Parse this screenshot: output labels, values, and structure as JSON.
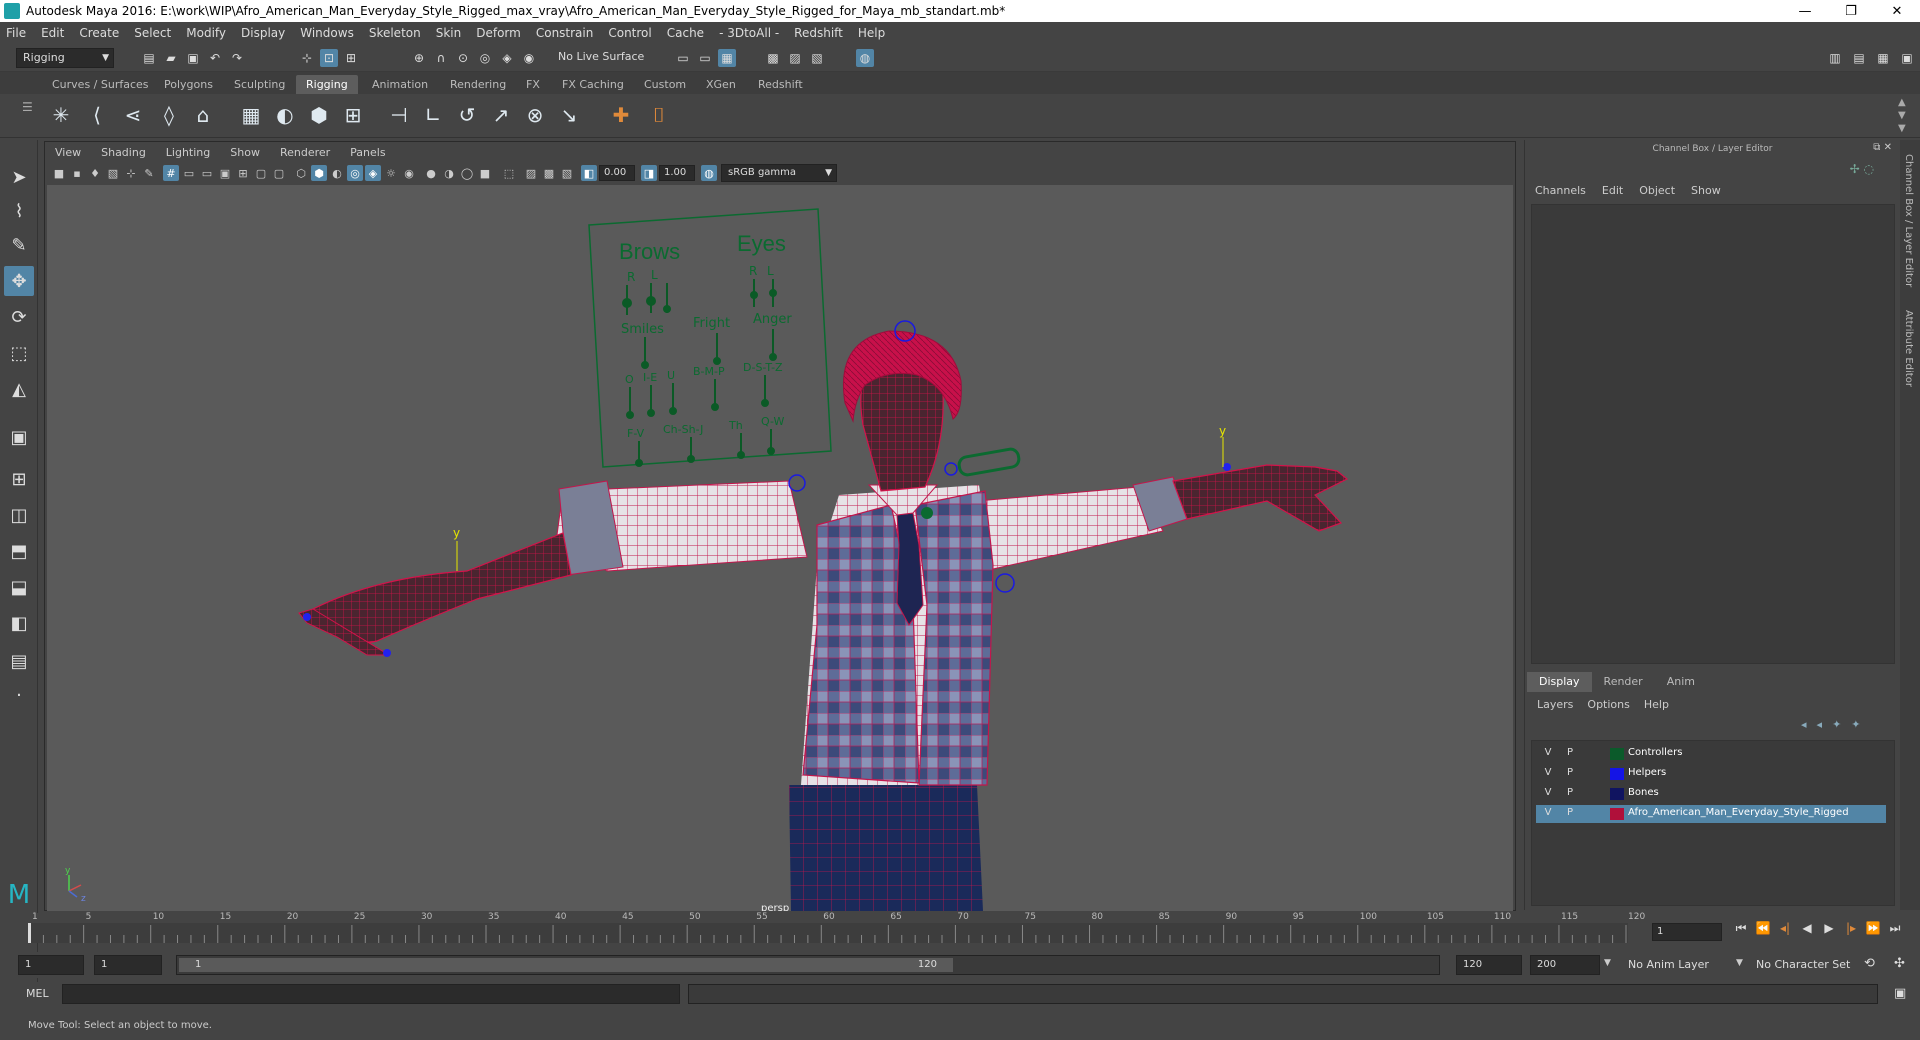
{
  "window": {
    "title": "Autodesk Maya 2016: E:\\work\\WIP\\Afro_American_Man_Everyday_Style_Rigged_max_vray\\Afro_American_Man_Everyday_Style_Rigged_for_Maya_mb_standart.mb*",
    "minimize": "—",
    "restore": "❐",
    "close": "✕"
  },
  "menubar": [
    "File",
    "Edit",
    "Create",
    "Select",
    "Modify",
    "Display",
    "Windows",
    "Skeleton",
    "Skin",
    "Deform",
    "Constrain",
    "Control",
    "Cache",
    "- 3DtoAll -",
    "Redshift",
    "Help"
  ],
  "statusline": {
    "mode": "Rigging",
    "live_surface": "No Live Surface"
  },
  "shelf_tabs": [
    {
      "label": "Curves / Surfaces",
      "active": false
    },
    {
      "label": "Polygons",
      "active": false
    },
    {
      "label": "Sculpting",
      "active": false
    },
    {
      "label": "Rigging",
      "active": true
    },
    {
      "label": "Animation",
      "active": false
    },
    {
      "label": "Rendering",
      "active": false
    },
    {
      "label": "FX",
      "active": false
    },
    {
      "label": "FX Caching",
      "active": false
    },
    {
      "label": "Custom",
      "active": false
    },
    {
      "label": "XGen",
      "active": false
    },
    {
      "label": "Redshift",
      "active": false
    }
  ],
  "panel": {
    "menu": [
      "View",
      "Shading",
      "Lighting",
      "Show",
      "Renderer",
      "Panels"
    ],
    "exposure": "0.00",
    "gamma": "1.00",
    "color_space": "sRGB gamma",
    "camera_label": "persp"
  },
  "facial_board": {
    "headers": [
      "Brows",
      "Eyes"
    ],
    "rl_labels": [
      "R",
      "L",
      "R",
      "L"
    ],
    "row2": [
      "Smiles",
      "Fright",
      "Anger"
    ],
    "row3": [
      "O",
      "I-E",
      "U",
      "B-M-P",
      "D-S-T-Z"
    ],
    "row4": [
      "F-V",
      "Ch-Sh-J",
      "Th",
      "Q-W"
    ]
  },
  "axis_labels": {
    "y": "y",
    "z": "z",
    "x": "x"
  },
  "channel_box": {
    "title": "Channel Box / Layer Editor",
    "menu": [
      "Channels",
      "Edit",
      "Object",
      "Show"
    ],
    "layer_tabs": [
      {
        "label": "Display",
        "active": true
      },
      {
        "label": "Render",
        "active": false
      },
      {
        "label": "Anim",
        "active": false
      }
    ],
    "layer_menu": [
      "Layers",
      "Options",
      "Help"
    ],
    "layers": [
      {
        "v": "V",
        "p": "P",
        "name": "Controllers",
        "color": "#0b5a2a",
        "selected": false
      },
      {
        "v": "V",
        "p": "P",
        "name": "Helpers",
        "color": "#1414e6",
        "selected": false
      },
      {
        "v": "V",
        "p": "P",
        "name": "Bones",
        "color": "#101460",
        "selected": false
      },
      {
        "v": "V",
        "p": "P",
        "name": "Afro_American_Man_Everyday_Style_Rigged",
        "color": "#b0103a",
        "selected": true
      }
    ]
  },
  "side_tabs": [
    "Channel Box / Layer Editor",
    "Attribute Editor"
  ],
  "timeline": {
    "ticks": [
      "1",
      "5",
      "10",
      "15",
      "20",
      "25",
      "30",
      "35",
      "40",
      "45",
      "50",
      "55",
      "60",
      "65",
      "70",
      "75",
      "80",
      "85",
      "90",
      "95",
      "100",
      "105",
      "110",
      "115",
      "120"
    ],
    "current_frame": "1"
  },
  "range": {
    "start": "1",
    "inner_start": "1",
    "slider_start": "1",
    "slider_end": "120",
    "end": "120",
    "anim_end": "200",
    "anim_layer": "No Anim Layer",
    "character_set": "No Character Set"
  },
  "command": {
    "label": "MEL"
  },
  "help": "Move Tool: Select an object to move."
}
